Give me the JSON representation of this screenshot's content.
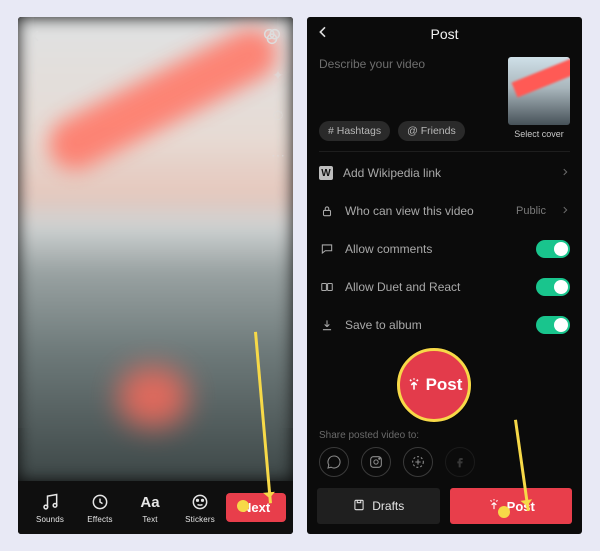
{
  "editor": {
    "tools": {
      "sounds": "Sounds",
      "effects": "Effects",
      "text": "Text",
      "stickers": "Stickers"
    },
    "next_label": "Next"
  },
  "post": {
    "title": "Post",
    "describe_placeholder": "Describe your video",
    "chip_hashtags": "# Hashtags",
    "chip_friends": "@ Friends",
    "cover_label": "Select cover",
    "items": {
      "wikipedia": "Add Wikipedia link",
      "privacy": "Who can view this video",
      "privacy_value": "Public",
      "comments": "Allow comments",
      "duet": "Allow Duet and React",
      "save": "Save to album"
    },
    "share_label": "Share posted video to:",
    "drafts_label": "Drafts",
    "post_label": "Post"
  },
  "callout": {
    "label": "Post"
  }
}
